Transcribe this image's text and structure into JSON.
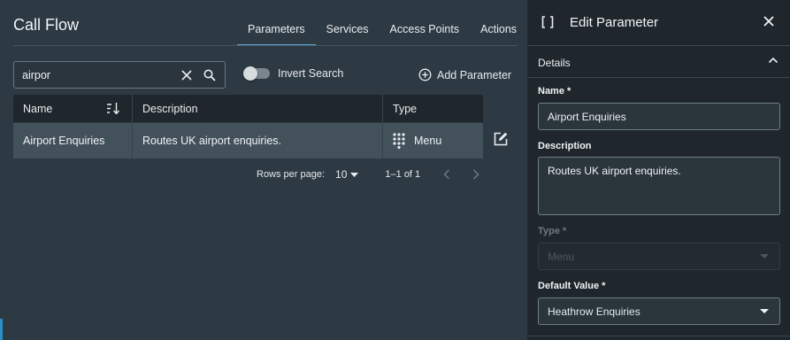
{
  "left": {
    "title": "Call Flow",
    "tabs": [
      {
        "label": "Parameters",
        "active": true
      },
      {
        "label": "Services"
      },
      {
        "label": "Access Points"
      },
      {
        "label": "Actions"
      }
    ],
    "search": {
      "value": "airpor",
      "clear_icon": "close-icon",
      "search_icon": "search-icon"
    },
    "invert_search": {
      "label": "Invert Search",
      "on": false
    },
    "add_parameter_label": "Add Parameter",
    "table": {
      "columns": [
        "Name",
        "Description",
        "Type"
      ],
      "rows": [
        {
          "name": "Airport Enquiries",
          "description": "Routes UK airport enquiries.",
          "type": "Menu",
          "type_icon": "dialpad-icon"
        }
      ]
    },
    "pagination": {
      "rows_per_page_label": "Rows per page:",
      "rows_per_page": "10",
      "range": "1–1 of 1"
    }
  },
  "right": {
    "title": "Edit Parameter",
    "section_label": "Details",
    "name_label": "Name *",
    "name_value": "Airport Enquiries",
    "description_label": "Description",
    "description_value": "Routes UK airport enquiries.",
    "type_label": "Type *",
    "type_value": "Menu",
    "default_value_label": "Default Value *",
    "default_value": "Heathrow Enquiries"
  },
  "colors": {
    "accent": "#5aa7d3",
    "panel_bg": "#2e3a43",
    "side_bg": "#1f272d"
  }
}
